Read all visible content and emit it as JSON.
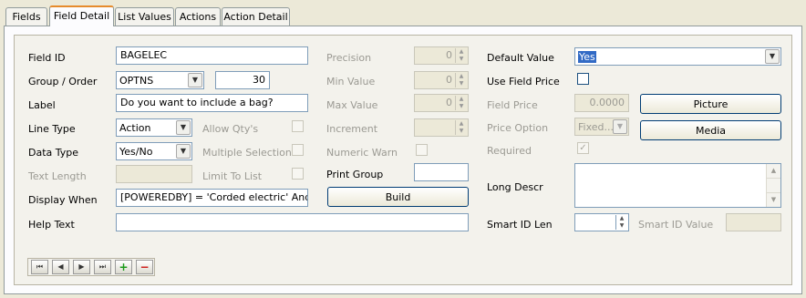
{
  "tabs": [
    "Fields",
    "Field Detail",
    "List Values",
    "Actions",
    "Action Detail"
  ],
  "form": {
    "field_id_label": "Field ID",
    "field_id": "BAGELEC",
    "group_order_label": "Group / Order",
    "group": "OPTNS",
    "order": "30",
    "label_label": "Label",
    "label": "Do you want to include a bag?",
    "line_type_label": "Line Type",
    "line_type": "Action",
    "data_type_label": "Data Type",
    "data_type": "Yes/No",
    "text_length_label": "Text Length",
    "display_when_label": "Display When",
    "display_when": "[POWEREDBY] = 'Corded electric' And [CO",
    "help_text_label": "Help Text",
    "allow_qty_label": "Allow Qty's",
    "multiple_selections_label": "Multiple Selections",
    "limit_to_list_label": "Limit To List",
    "precision_label": "Precision",
    "precision": "0",
    "min_value_label": "Min Value",
    "min_value": "0",
    "max_value_label": "Max Value",
    "max_value": "0",
    "increment_label": "Increment",
    "numeric_warn_label": "Numeric Warn",
    "print_group_label": "Print Group",
    "build_label": "Build",
    "default_value_label": "Default Value",
    "default_value": "Yes",
    "use_field_price_label": "Use Field Price",
    "field_price_label": "Field Price",
    "field_price": "0.0000",
    "picture_label": "Picture",
    "price_option_label": "Price Option",
    "price_option": "Fixed...",
    "media_label": "Media",
    "required_label": "Required",
    "long_descr_label": "Long Descr",
    "smart_id_len_label": "Smart ID Len",
    "smart_id_value_label": "Smart ID Value"
  },
  "icons": {
    "first": "first-record-icon",
    "prev": "previous-record-icon",
    "next": "next-record-icon",
    "last": "last-record-icon",
    "add": "add-record-icon",
    "delete": "delete-record-icon"
  },
  "colors": {
    "add": "#1a9a1a",
    "delete": "#cc1111",
    "selection": "#316ac5"
  }
}
